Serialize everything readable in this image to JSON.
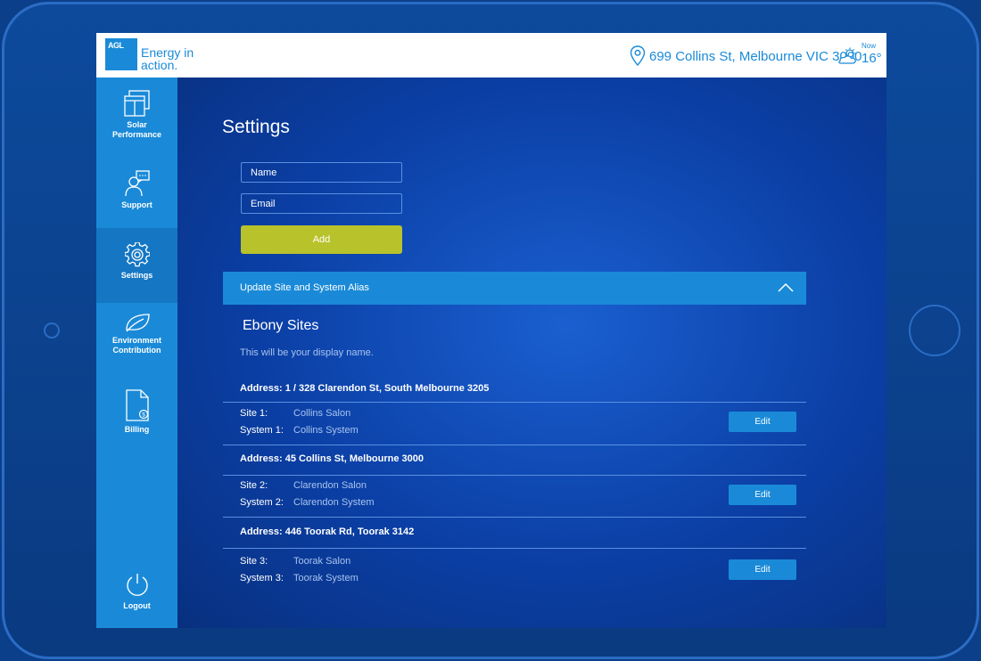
{
  "header": {
    "logo_mark": "AGL",
    "logo_text": "Energy in action.",
    "location": "699 Collins St, Melbourne VIC 3000",
    "weather_now": "Now",
    "weather_temp": "16°",
    "weather_icon": "partly-cloudy-icon"
  },
  "sidebar": {
    "items": [
      {
        "label": "Solar Performance",
        "icon": "solar-panel-icon"
      },
      {
        "label": "Support",
        "icon": "support-chat-icon"
      },
      {
        "label": "Settings",
        "icon": "gear-icon",
        "active": true
      },
      {
        "label": "Environment Contribution",
        "icon": "leaf-icon"
      },
      {
        "label": "Billing",
        "icon": "bill-document-icon"
      }
    ],
    "logout": {
      "label": "Logout",
      "icon": "power-icon"
    }
  },
  "settings": {
    "title": "Settings",
    "name_placeholder": "Name",
    "email_placeholder": "Email",
    "add_label": "Add",
    "accordion_label": "Update Site and System Alias",
    "section_title": "Ebony Sites",
    "section_sub": "This will be your display name.",
    "groups": [
      {
        "address": "Address: 1 / 328 Clarendon St, South Melbourne 3205",
        "site_label": "Site 1:",
        "site_value": "Collins Salon",
        "system_label": "System 1:",
        "system_value": "Collins System",
        "edit_label": "Edit"
      },
      {
        "address": "Address: 45 Collins St, Melbourne 3000",
        "site_label": "Site 2:",
        "site_value": "Clarendon Salon",
        "system_label": "System 2:",
        "system_value": "Clarendon System",
        "edit_label": "Edit"
      },
      {
        "address": "Address: 446 Toorak Rd, Toorak 3142",
        "site_label": "Site 3:",
        "site_value": "Toorak Salon",
        "system_label": "System 3:",
        "system_value": "Toorak System",
        "edit_label": "Edit"
      }
    ]
  },
  "colors": {
    "brand": "#1a8ad8",
    "accent_add": "#b8c22a",
    "background": "#0b3fa5"
  }
}
